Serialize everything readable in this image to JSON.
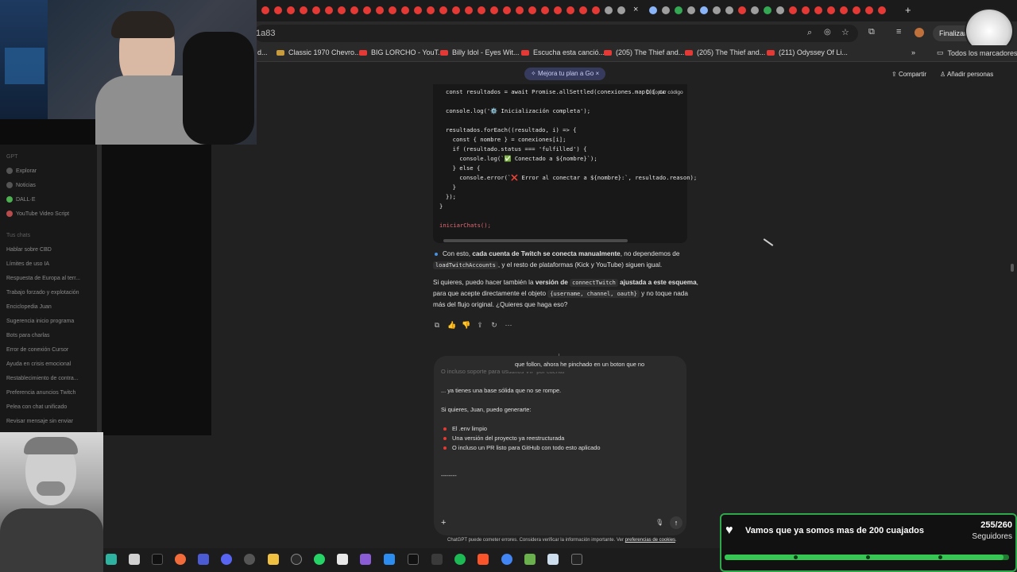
{
  "browser": {
    "url_fragment": "1a83",
    "finish_button": "Finalizar a",
    "new_tab": "+",
    "close_tab": "×",
    "bookmarks": [
      {
        "label": "d...",
        "icon": "none"
      },
      {
        "label": "Classic 1970 Chevro...",
        "icon": "bookmark-icon"
      },
      {
        "label": "BIG LORCHO - YouT...",
        "icon": "youtube-icon"
      },
      {
        "label": "Billy Idol - Eyes Wit...",
        "icon": "youtube-icon"
      },
      {
        "label": "Escucha esta canció...",
        "icon": "youtube-icon"
      },
      {
        "label": "(205) The Thief and...",
        "icon": "youtube-icon"
      },
      {
        "label": "(205) The Thief and...",
        "icon": "youtube-icon"
      },
      {
        "label": "(211) Odyssey Of Li...",
        "icon": "youtube-icon"
      }
    ],
    "bookmarks_more": "»",
    "all_bookmarks": "Todos los marcadores"
  },
  "header": {
    "upgrade": "Mejora tu plan a Go",
    "upgrade_close": "×",
    "share": "Compartir",
    "add_people": "Añadir personas"
  },
  "sidebar": {
    "section_gpt": "GPT",
    "gpts": [
      "Explorar",
      "Noticias",
      "DALL·E",
      "YouTube Video Script"
    ],
    "section_chats": "Tus chats",
    "chats": [
      "Hablar sobre CBD",
      "Límites de uso IA",
      "Respuesta de Europa al terr...",
      "Trabajo forzado y explotación",
      "Enciclopedia Juan",
      "Sugerencia inicio programa",
      "Bots para charlas",
      "Error de conexión Cursor",
      "Ayuda en crisis emocional",
      "Restablecimiento de contra...",
      "Preferencia anuncios Twitch",
      "Pelea con chat unificado",
      "Revisar mensaje sin enviar"
    ]
  },
  "code": {
    "copy_label": "Copiar código",
    "lines": [
      "const resultados = await Promise.allSettled(conexiones.map(({ cc",
      "",
      "console.log('⚙️ Inicialización completa');",
      "",
      "resultados.forEach((resultado, i) => {",
      "  const { nombre } = conexiones[i];",
      "  if (resultado.status === 'fulfilled') {",
      "    console.log(`✅ Conectado a ${nombre}`);",
      "  } else {",
      "    console.error(`❌ Error al conectar a ${nombre}:`, resultado.reason);",
      "  }",
      "});",
      "}",
      "",
      "iniciarChats();"
    ]
  },
  "message": {
    "p1_a": "Con esto, ",
    "p1_b": "cada cuenta de Twitch se conecta manualmente",
    "p1_c": ", no dependemos de",
    "p1_code": "loadTwitchAccounts",
    "p1_d": ", y el resto de plataformas (Kick y YouTube) siguen igual.",
    "p2_a": "Si quieres, puedo hacer también la ",
    "p2_b": "versión de",
    "p2_code": "connectTwitch",
    "p2_c": "ajustada a este esquema",
    "p2_d": ",",
    "p3_a": "para que acepte directamente el objeto",
    "p3_code": "{username, channel, oauth}",
    "p3_b": "y no toque nada",
    "p4": "más del flujo original. ¿Quieres que haga eso?"
  },
  "composer": {
    "user_line": "que follon, ahora he pinchado en un boton que no",
    "faded_line": "O incluso soporte para usuarios VIP por cuenta",
    "l1": "... ya tienes una base sólida que no se rompe.",
    "l2": "Si quieres, Juan, puedo generarte:",
    "bullets": [
      "El .env limpio",
      "Una versión del proyecto ya reestructurada",
      "O incluso un PR listo para GitHub con todo esto aplicado"
    ],
    "divider": "--------",
    "plus": "+",
    "send": "↑",
    "mic": "🎙"
  },
  "footer": {
    "note": "ChatGPT puede cometer errores. Considera verificar la información importante. Ver ",
    "link": "preferencias de cookies",
    "dot": "."
  },
  "goal": {
    "text": "Vamos que ya somos mas de 200 cuajados",
    "count": "255/260",
    "label": "Seguidores",
    "progress": 0.98
  },
  "colors": {
    "goal_green": "#35c653",
    "youtube_red": "#e53935",
    "accent_blue": "#4a90e2"
  }
}
